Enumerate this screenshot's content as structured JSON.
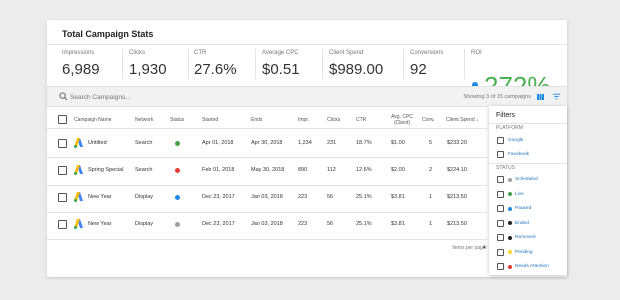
{
  "header": {
    "title": "Total Campaign Stats"
  },
  "stats": [
    {
      "label": "Impressions",
      "value": "6,989"
    },
    {
      "label": "Clicks",
      "value": "1,930"
    },
    {
      "label": "CTR",
      "value": "27.6%"
    },
    {
      "label": "Average CPC",
      "value": "$0.51"
    },
    {
      "label": "Client Spend",
      "value": "$989.00"
    },
    {
      "label": "Conversions",
      "value": "92"
    }
  ],
  "roi": {
    "label": "ROI",
    "value": "272%",
    "color": "#4caf50"
  },
  "search": {
    "placeholder": "Search Campaigns..."
  },
  "showing": "Showing 3 of 15 campaigns",
  "table": {
    "columns": [
      "Campaign Name",
      "Network",
      "Status",
      "Started",
      "Ends",
      "Impr.",
      "Clicks",
      "CTR",
      "Avg. CPC (Client)",
      "Conv.",
      "Client Spend"
    ],
    "rows": [
      {
        "name": "Untitled",
        "network": "Search",
        "status": "Live",
        "status_color": "#43a047",
        "started": "Apr 01, 2018",
        "ends": "Apr 30, 2018",
        "impr": "1,234",
        "clicks": "231",
        "ctr": "18.7%",
        "cpc": "$1.00",
        "conv": "5",
        "spend": "$233.20"
      },
      {
        "name": "Spring Special",
        "network": "Search",
        "status": "Needs Attention",
        "status_color": "#e53935",
        "started": "Feb 01, 2018",
        "ends": "May 30, 2018",
        "impr": "890",
        "clicks": "112",
        "ctr": "12.6%",
        "cpc": "$2.00",
        "conv": "2",
        "spend": "$224.10"
      },
      {
        "name": "New Year",
        "network": "Display",
        "status": "Paused",
        "status_color": "#1e88e5",
        "started": "Dec 23, 2017",
        "ends": "Jan 03, 2018",
        "impr": "223",
        "clicks": "56",
        "ctr": "25.1%",
        "cpc": "$3.81",
        "conv": "1",
        "spend": "$213.50"
      },
      {
        "name": "New Year",
        "network": "Display",
        "status": "Scheduled",
        "status_color": "#9e9e9e",
        "started": "Dec 23, 2017",
        "ends": "Jan 03, 2018",
        "impr": "223",
        "clicks": "56",
        "ctr": "25.1%",
        "cpc": "$3.81",
        "conv": "1",
        "spend": "$213.50"
      }
    ]
  },
  "footer": {
    "label": "Items per page:",
    "value": "4"
  },
  "filters": {
    "title": "Filters",
    "platform_label": "PLATFORM",
    "platform": [
      "Google",
      "Facebook"
    ],
    "status_label": "STATUS",
    "status": [
      {
        "label": "Scheduled",
        "color": "#9e9e9e"
      },
      {
        "label": "Live",
        "color": "#43a047"
      },
      {
        "label": "Paused",
        "color": "#1e88e5"
      },
      {
        "label": "Ended",
        "color": "#212121"
      },
      {
        "label": "Removed",
        "color": "#212121"
      },
      {
        "label": "Pending",
        "color": "#fdd835"
      },
      {
        "label": "Needs Attention",
        "color": "#e53935"
      }
    ]
  },
  "colors": {
    "accent": "#1e88e5",
    "google_blue": "#4285f4",
    "google_yellow": "#fbbc05"
  }
}
